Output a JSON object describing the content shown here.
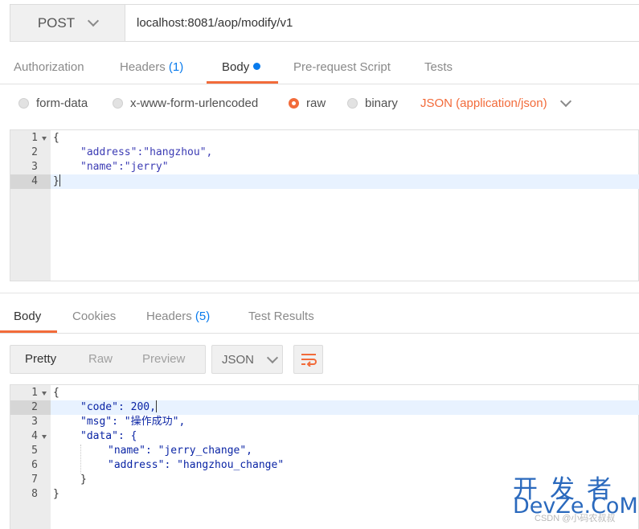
{
  "request": {
    "method": "POST",
    "url": "localhost:8081/aop/modify/v1"
  },
  "request_tabs": [
    {
      "label": "Authorization",
      "count": ""
    },
    {
      "label": "Headers",
      "count": "(1)"
    },
    {
      "label": "Body",
      "count": ""
    },
    {
      "label": "Pre-request Script",
      "count": ""
    },
    {
      "label": "Tests",
      "count": ""
    }
  ],
  "active_request_tab": "Body",
  "body_types": [
    {
      "label": "form-data",
      "selected": false
    },
    {
      "label": "x-www-form-urlencoded",
      "selected": false
    },
    {
      "label": "raw",
      "selected": true
    },
    {
      "label": "binary",
      "selected": false
    }
  ],
  "content_type": "JSON (application/json)",
  "request_body": {
    "line_numbers": [
      "1",
      "2",
      "3",
      "4"
    ],
    "lines": [
      "{",
      "\"address\":\"hangzhou\",",
      "\"name\":\"jerry\"",
      "}"
    ]
  },
  "response_tabs": [
    {
      "label": "Body",
      "count": ""
    },
    {
      "label": "Cookies",
      "count": ""
    },
    {
      "label": "Headers",
      "count": "(5)"
    },
    {
      "label": "Test Results",
      "count": ""
    }
  ],
  "active_response_tab": "Body",
  "view_modes": [
    "Pretty",
    "Raw",
    "Preview"
  ],
  "active_view_mode": "Pretty",
  "format": "JSON",
  "response_body": {
    "line_numbers": [
      "1",
      "2",
      "3",
      "4",
      "5",
      "6",
      "7",
      "8"
    ],
    "lines": [
      "{",
      "\"code\": 200,",
      "\"msg\": \"操作成功\",",
      "\"data\": {",
      "\"name\": \"jerry_change\",",
      "\"address\": \"hangzhou_change\"",
      "}",
      "}"
    ]
  },
  "watermark": {
    "cn": "开发者",
    "en": "DevZe.CoM",
    "small": "CSDN @小码农叔叔"
  },
  "colors": {
    "accent": "#f26b3a",
    "count_blue": "#097bed",
    "watermark_blue": "#2a69bd"
  }
}
